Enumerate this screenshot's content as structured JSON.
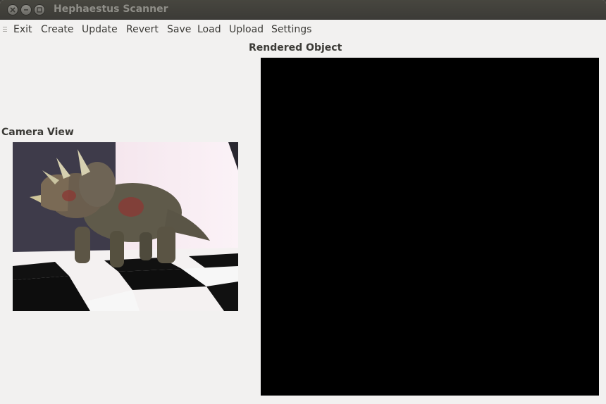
{
  "window": {
    "title": "Hephaestus Scanner"
  },
  "menu": {
    "items": [
      "Exit",
      "Create",
      "Update",
      "Revert",
      "Save",
      "Load",
      "Upload",
      "Settings"
    ]
  },
  "camera_view": {
    "label": "Camera View",
    "image": "triceratops-toy-on-checkerboard"
  },
  "rendered_object": {
    "label": "Rendered Object",
    "background": "#000000"
  },
  "colors": {
    "titlebar": "#3c3b37",
    "window_bg": "#f2f1f0",
    "text": "#3c3b37"
  }
}
